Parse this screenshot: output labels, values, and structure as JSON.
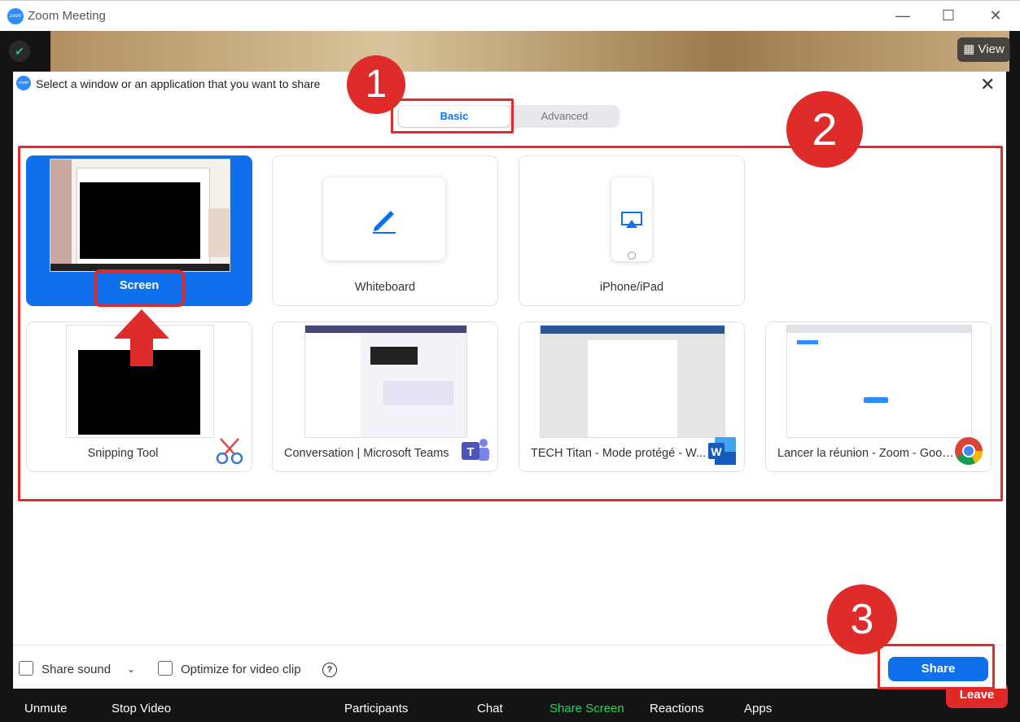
{
  "window": {
    "title": "Zoom Meeting",
    "minimize": "—",
    "maximize": "☐",
    "close": "✕",
    "view_label": "View"
  },
  "dialog": {
    "title": "Select a window or an application that you want to share",
    "tabs": {
      "basic": "Basic",
      "advanced": "Advanced"
    },
    "cards": {
      "screen": "Screen",
      "whiteboard": "Whiteboard",
      "iphone": "iPhone/iPad",
      "snipping": "Snipping Tool",
      "teams": "Conversation | Microsoft Teams",
      "word": "TECH Titan  -  Mode protégé - W...",
      "chrome": "Lancer la réunion - Zoom - Googl..."
    },
    "footer": {
      "share_sound": "Share sound",
      "optimize": "Optimize for video clip",
      "help": "?",
      "share_button": "Share"
    }
  },
  "toolbar": {
    "unmute": "Unmute",
    "stop_video": "Stop Video",
    "participants": "Participants",
    "chat": "Chat",
    "share_screen": "Share Screen",
    "reactions": "Reactions",
    "apps": "Apps",
    "leave": "Leave"
  },
  "annotations": {
    "step1": "1",
    "step2": "2",
    "step3": "3"
  },
  "colors": {
    "accent": "#0e71eb",
    "annotation": "#e02b2b",
    "share_screen_green": "#23d959",
    "leave_red": "#e02828"
  }
}
